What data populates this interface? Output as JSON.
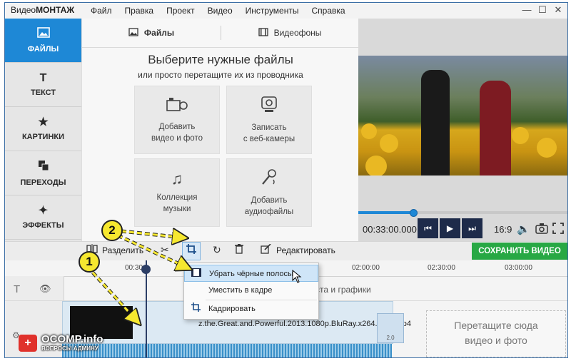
{
  "app": {
    "brand_prefix": "Видео",
    "brand_suffix": "МОНТАЖ"
  },
  "menu": [
    "Файл",
    "Правка",
    "Проект",
    "Видео",
    "Инструменты",
    "Справка"
  ],
  "window_controls": {
    "minimize": "—",
    "maximize": "☐",
    "close": "✕"
  },
  "sidebar": {
    "items": [
      {
        "label": "ФАЙЛЫ",
        "icon": "image-icon",
        "active": true
      },
      {
        "label": "ТЕКСТ",
        "icon": "text-icon"
      },
      {
        "label": "КАРТИНКИ",
        "icon": "star-icon"
      },
      {
        "label": "ПЕРЕХОДЫ",
        "icon": "transitions-icon"
      },
      {
        "label": "ЭФФЕКТЫ",
        "icon": "magic-wand-icon"
      }
    ]
  },
  "tabs": [
    {
      "label": "Файлы",
      "icon": "image-icon",
      "active": true
    },
    {
      "label": "Видеофоны",
      "icon": "film-icon"
    }
  ],
  "files_panel": {
    "heading": "Выберите нужные файлы",
    "subheading": "или просто перетащите их из проводника",
    "cards": [
      {
        "line1": "Добавить",
        "line2": "видео и фото",
        "icon": "add-video-icon"
      },
      {
        "line1": "Записать",
        "line2": "с веб-камеры",
        "icon": "webcam-icon"
      },
      {
        "line1": "Коллекция",
        "line2": "музыки",
        "icon": "music-icon"
      },
      {
        "line1": "Добавить",
        "line2": "аудиофайлы",
        "icon": "microphone-icon"
      }
    ]
  },
  "preview": {
    "timecode": "00:33:00.000",
    "aspect_ratio": "16:9",
    "seek_progress": 0.26
  },
  "toolbar": {
    "split_label": "Разделить",
    "edit_label": "Редактировать",
    "save_label": "СОХРАНИТЬ ВИДЕО"
  },
  "crop_menu": {
    "items": [
      {
        "label": "Убрать чёрные полосы",
        "icon": "letterbox-icon",
        "highlighted": true
      },
      {
        "label": "Уместить в кадре",
        "icon": "fit-icon"
      },
      {
        "label": "Кадрировать",
        "icon": "crop-icon"
      }
    ]
  },
  "timeline": {
    "ruler": [
      "00:30",
      "02:00:00",
      "02:30:00",
      "03:00:00"
    ],
    "text_track_hint": "авления текста и графики",
    "clip_name": "z.the.Great.and.Powerful.2013.1080p.BluRay.x264.YIFY.mp4",
    "clip_end_label": "2.0",
    "drop_hint_line1": "Перетащите сюда",
    "drop_hint_line2": "видео и фото"
  },
  "annotations": {
    "badge1": "1",
    "badge2": "2"
  },
  "watermark": {
    "logo": "+",
    "title": "OCOMP.info",
    "subtitle": "ВОПРОСЫ АДМИНУ"
  },
  "colors": {
    "accent": "#1e88d6",
    "save": "#27a844",
    "annotation": "#f6e82f"
  }
}
